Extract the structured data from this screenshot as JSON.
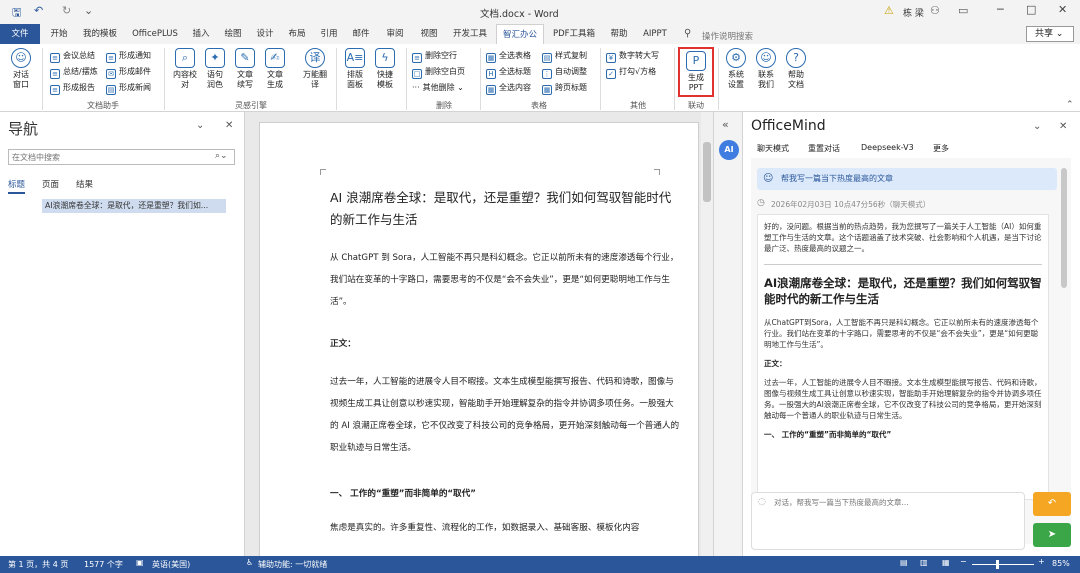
{
  "window": {
    "title": "文档.docx - Word",
    "user": "栋 梁",
    "share": "共享"
  },
  "tabs": [
    {
      "label": "文件"
    },
    {
      "label": "开始"
    },
    {
      "label": "我的模板"
    },
    {
      "label": "OfficePLUS"
    },
    {
      "label": "插入"
    },
    {
      "label": "绘图"
    },
    {
      "label": "设计"
    },
    {
      "label": "布局"
    },
    {
      "label": "引用"
    },
    {
      "label": "邮件"
    },
    {
      "label": "审阅"
    },
    {
      "label": "视图"
    },
    {
      "label": "开发工具"
    },
    {
      "label": "智汇办公"
    },
    {
      "label": "PDF工具箱"
    },
    {
      "label": "帮助"
    },
    {
      "label": "AIPPT"
    }
  ],
  "search_hint": "操作说明搜索",
  "ribbon": {
    "dialog": "对话\n窗口",
    "doc_helper": {
      "items": [
        "会议总结",
        "形成通知",
        "总结/摆炼",
        "形成邮件",
        "形成报告",
        "形成新闻"
      ],
      "label": "文档助手"
    },
    "ling_engine": {
      "items": [
        "内容校\n对",
        "语句\n润色",
        "文章\n续写",
        "文章\n生成",
        "万能翻\n译"
      ],
      "label": "灵感引擎"
    },
    "layout_btns": [
      "排版\n面板",
      "快捷\n模板"
    ],
    "delete": {
      "items": [
        "删除空行",
        "删除空白页",
        "其他删除"
      ],
      "label": "删除"
    },
    "table": {
      "items": [
        "全选表格",
        "样式复制",
        "全选标题",
        "自动调整",
        "全选内容",
        "跨页标题"
      ],
      "label": "表格"
    },
    "other": {
      "items": [
        "数字转大写",
        "打勾√方格"
      ],
      "label": "其他"
    },
    "link": {
      "button": "生成\nPPT",
      "label": "联动"
    },
    "system": [
      "系统\n设置",
      "联系\n我们",
      "帮助\n文档"
    ]
  },
  "nav": {
    "title": "导航",
    "search_placeholder": "在文档中搜索",
    "tabs": [
      "标题",
      "页面",
      "结果"
    ],
    "heading": "AI浪潮席卷全球：是取代，还是重塑？我们如..."
  },
  "doc": {
    "title": "AI 浪潮席卷全球：是取代，还是重塑？我们如何驾驭智能时代的新工作与生活",
    "p1": "从 ChatGPT 到 Sora，人工智能不再只是科幻概念。它正以前所未有的速度渗透每个行业，我们站在变革的十字路口，需要思考的不仅是“会不会失业”，更是“如何更聪明地工作与生活”。",
    "body_label": "正文：",
    "p2": "过去一年，人工智能的进展令人目不暇接。文本生成模型能撰写报告、代码和诗歌，图像与视频生成工具让创意以秒速实现，智能助手开始理解复杂的指令并协调多项任务。一股强大的 AI 浪潮正席卷全球，它不仅改变了科技公司的竞争格局，更开始深刻触动每一个普通人的职业轨迹与日常生活。",
    "h1": "一、 工作的“重塑”而非简单的“取代”",
    "p3": "焦虑是真实的。许多重复性、流程化的工作，如数据录入、基础客服、模板化内容"
  },
  "officemind": {
    "title": "OfficeMind",
    "tabs": [
      "聊天模式",
      "重置对话",
      "Deepseek-V3",
      "更多"
    ],
    "user_msg": "帮我写一篇当下热度最高的文章",
    "timestamp": "2026年02月03日 10点47分56秒（聊天模式）",
    "reply_intro": "好的，没问题。根据当前的热点趋势，我为您撰写了一篇关于人工智能（AI）如何重塑工作与生活的文章。这个话题涵盖了技术突破、社会影响和个人机遇，是当下讨论最广泛、热度最高的议题之一。",
    "reply_title": "AI浪潮席卷全球：是取代，还是重塑？我们如何驾驭智能时代的新工作与生活",
    "reply_p1": "从ChatGPT到Sora，人工智能不再只是科幻概念。它正以前所未有的速度渗透每个行业。我们站在变革的十字路口，需要思考的不仅是“会不会失业”，更是“如何更聪明地工作与生活”。",
    "reply_body": "正文：",
    "reply_p2": "过去一年，人工智能的进展令人目不暇接。文本生成模型能撰写报告、代码和诗歌，图像与视频生成工具让创意以秒速实现，智能助手开始理解复杂的指令并协调多项任务。一股强大的AI浪潮正席卷全球，它不仅改变了科技公司的竞争格局，更开始深刻触动每一个普通人的职业轨迹与日常生活。",
    "reply_h1": "一、 工作的“重塑”而非简单的“取代”",
    "input_placeholder": "对话，帮我写一篇当下热度最高的文章..."
  },
  "status": {
    "page": "第 1 页，共 4 页",
    "words": "1577 个字",
    "lang": "英语(美国)",
    "access": "辅助功能: 一切就绪",
    "zoom": "85%"
  }
}
